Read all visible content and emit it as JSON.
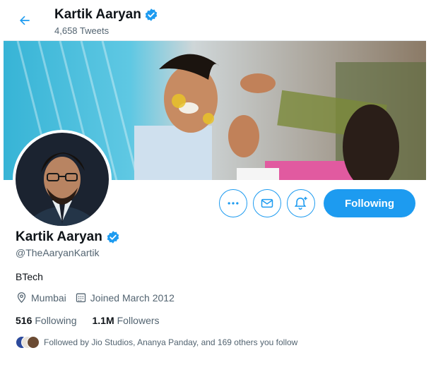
{
  "header": {
    "name": "Kartik Aaryan",
    "tweet_count": "4,658 Tweets"
  },
  "profile": {
    "name": "Kartik Aaryan",
    "handle": "@TheAaryanKartik",
    "bio": "BTech",
    "location": "Mumbai",
    "joined": "Joined March 2012",
    "following_count": "516",
    "following_label": "Following",
    "followers_count": "1.1M",
    "followers_label": "Followers",
    "followed_by": "Followed by Jio Studios, Ananya Panday, and 169 others you follow"
  },
  "actions": {
    "follow_label": "Following"
  },
  "icons": {
    "back": "arrow-left-icon",
    "verified": "verified-badge-icon",
    "more": "more-icon",
    "message": "envelope-icon",
    "notify": "bell-plus-icon",
    "location": "location-pin-icon",
    "calendar": "calendar-icon"
  },
  "colors": {
    "accent": "#1d9bf0",
    "text": "#0f1419",
    "secondary": "#536471"
  }
}
